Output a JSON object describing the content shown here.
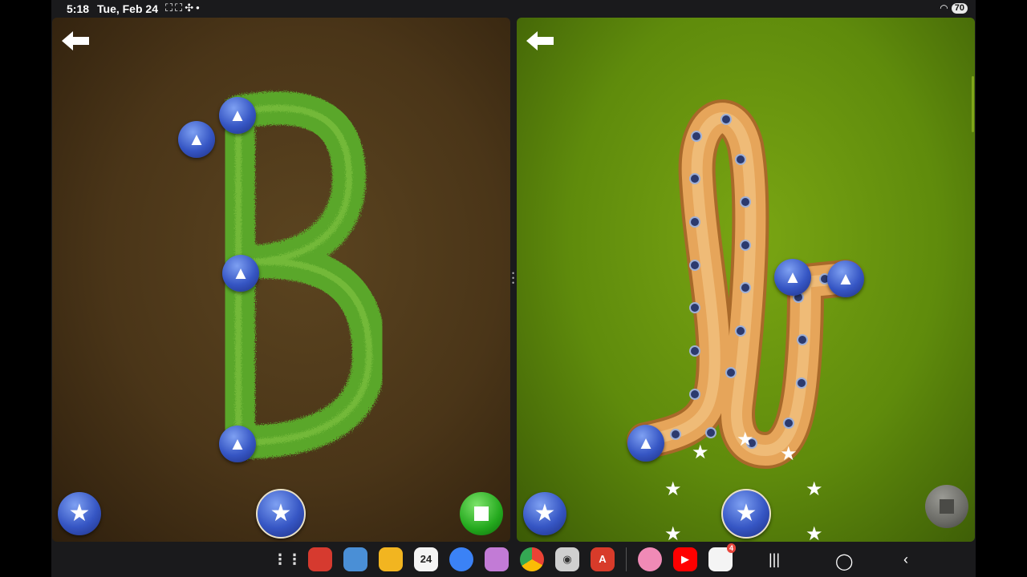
{
  "status_bar": {
    "time": "5:18",
    "date": "Tue, Feb 24",
    "battery": "70"
  },
  "left_panel": {
    "letter": "B",
    "theme_colors": {
      "bg": "#4a3518",
      "stroke": "#5aa72a"
    }
  },
  "right_panel": {
    "letter": "cursive b",
    "theme_colors": {
      "bg": "#5f8b0c",
      "stroke": "#e6a55a"
    }
  },
  "dock": {
    "apps": [
      {
        "name": "notes-app-icon",
        "color": "#d63a2f",
        "label": ""
      },
      {
        "name": "game-app-icon",
        "color": "#4a8fd6",
        "label": ""
      },
      {
        "name": "files-app-icon",
        "color": "#f2b520",
        "label": ""
      },
      {
        "name": "calendar-app-icon",
        "color": "#2aa8a0",
        "label": "24"
      },
      {
        "name": "messages-app-icon",
        "color": "#3b82f6",
        "label": ""
      },
      {
        "name": "cat-app-icon",
        "color": "#c27bd6",
        "label": ""
      },
      {
        "name": "chrome-app-icon",
        "color": "#e8e8e8",
        "label": ""
      },
      {
        "name": "camera-app-icon",
        "color": "#cfcfcf",
        "label": ""
      },
      {
        "name": "abc-app-icon",
        "color": "#d83b2a",
        "label": "A"
      },
      {
        "name": "flower-app-icon",
        "color": "#f08ab6",
        "label": ""
      },
      {
        "name": "youtube-app-icon",
        "color": "#ff0000",
        "label": ""
      },
      {
        "name": "photos-app-icon",
        "color": "#f4f4f4",
        "label": "",
        "badge": "4"
      }
    ]
  }
}
